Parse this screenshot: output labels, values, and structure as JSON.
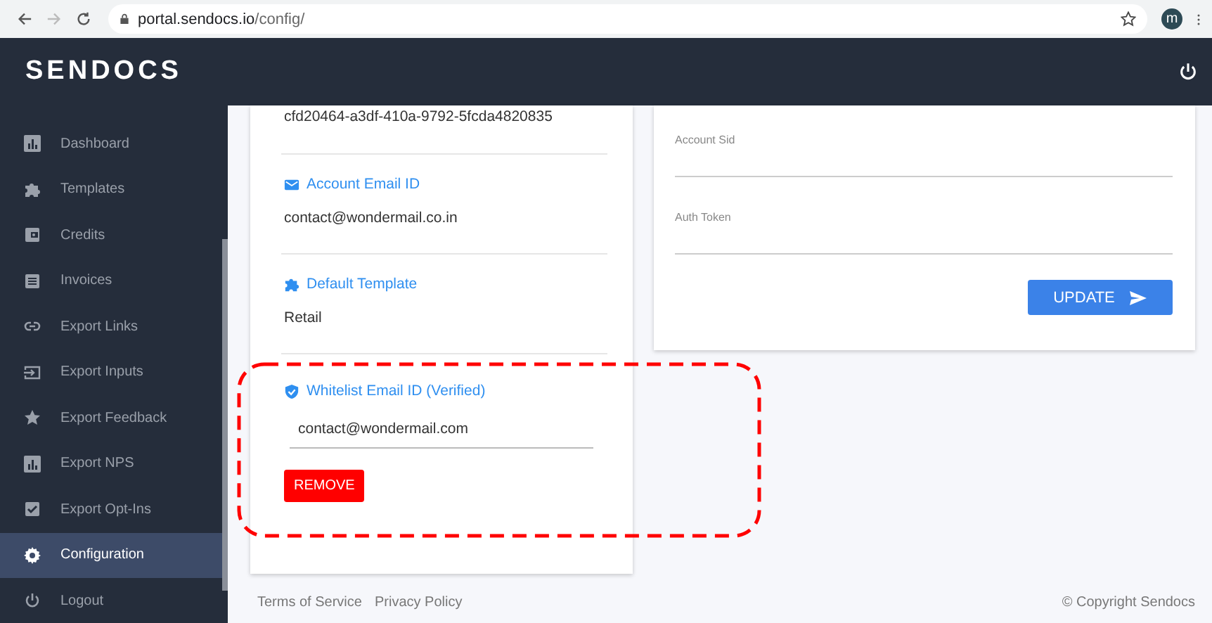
{
  "browser": {
    "url_host": "portal.sendocs.io",
    "url_path": "/config/",
    "avatar": "m"
  },
  "header": {
    "logo": "SENDOCS"
  },
  "sidebar": {
    "items": [
      {
        "label": "Dashboard",
        "selected": false
      },
      {
        "label": "Templates",
        "selected": false
      },
      {
        "label": "Credits",
        "selected": false
      },
      {
        "label": "Invoices",
        "selected": false
      },
      {
        "label": "Export Links",
        "selected": false
      },
      {
        "label": "Export Inputs",
        "selected": false
      },
      {
        "label": "Export Feedback",
        "selected": false
      },
      {
        "label": "Export NPS",
        "selected": false
      },
      {
        "label": "Export Opt-Ins",
        "selected": false
      },
      {
        "label": "Configuration",
        "selected": true
      },
      {
        "label": "Logout",
        "selected": false
      }
    ]
  },
  "account_card": {
    "id_value": "cfd20464-a3df-410a-9792-5fcda4820835",
    "sections": [
      {
        "label": "Account Email ID",
        "value": "contact@wondermail.co.in"
      },
      {
        "label": "Default Template",
        "value": "Retail"
      }
    ],
    "whitelist": {
      "label": "Whitelist Email ID (Verified)",
      "value": "contact@wondermail.com",
      "button": "REMOVE"
    }
  },
  "settings_card": {
    "fields": [
      {
        "label": "Account Sid"
      },
      {
        "label": "Auth Token"
      }
    ],
    "button": "UPDATE"
  },
  "footer": {
    "links": [
      "Terms of Service",
      "Privacy Policy"
    ],
    "copyright": "© Copyright Sendocs"
  }
}
